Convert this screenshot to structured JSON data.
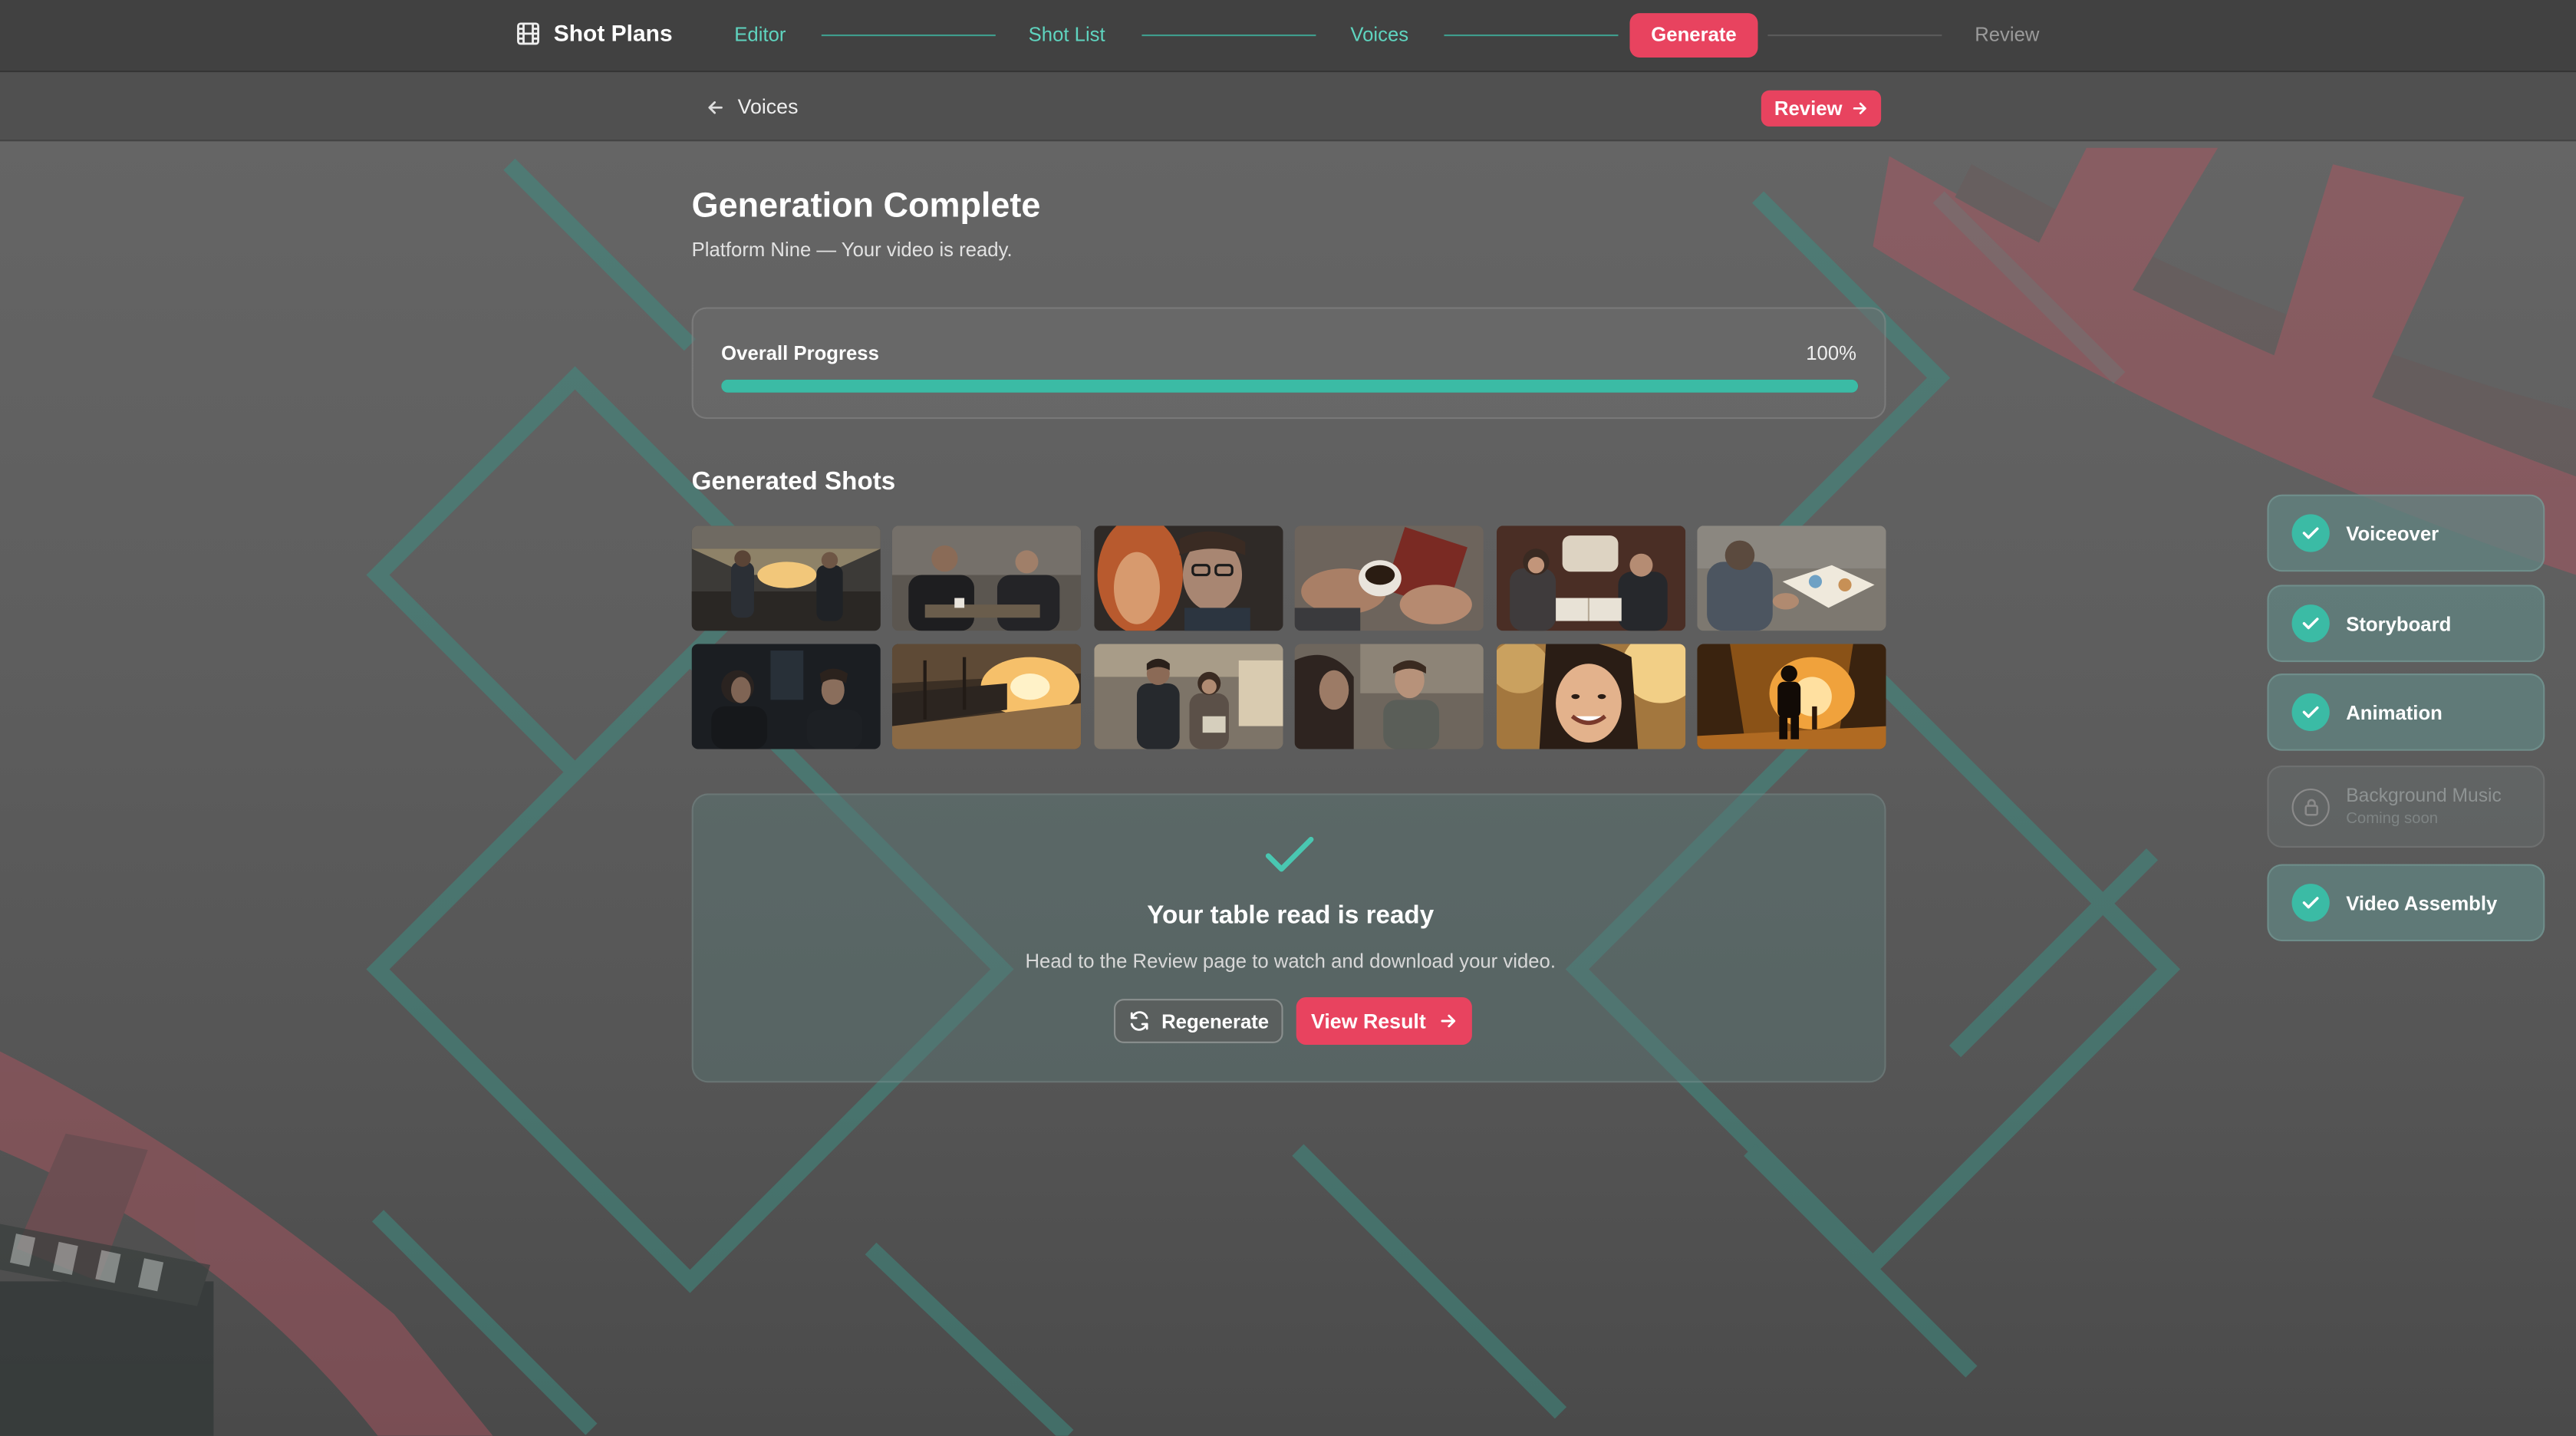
{
  "nav": {
    "brand": "Shot Plans",
    "steps": [
      {
        "label": "Editor",
        "state": "done"
      },
      {
        "label": "Shot List",
        "state": "done"
      },
      {
        "label": "Voices",
        "state": "done"
      },
      {
        "label": "Generate",
        "state": "active"
      },
      {
        "label": "Review",
        "state": "todo"
      }
    ]
  },
  "subbar": {
    "back_label": "Voices",
    "review_label": "Review"
  },
  "page": {
    "title": "Generation Complete",
    "subtitle": "Platform Nine — Your video is ready."
  },
  "progress": {
    "label": "Overall Progress",
    "value_text": "100%",
    "value": 100
  },
  "shots": {
    "title": "Generated Shots",
    "items": [
      "station-couple-talking",
      "two-people-at-table",
      "man-with-glasses-closeup",
      "hands-holding-cup",
      "couple-on-train",
      "man-reading-sketchbook",
      "dark-train-conversation",
      "sunlit-platform",
      "couple-on-platform",
      "woman-and-young-man",
      "smiling-woman",
      "silhouette-in-tunnel"
    ]
  },
  "ready": {
    "title": "Your table read is ready",
    "subtitle": "Head to the Review page to watch and download your video.",
    "regenerate_label": "Regenerate",
    "view_label": "View Result"
  },
  "status": {
    "items": [
      {
        "label": "Voiceover",
        "state": "complete"
      },
      {
        "label": "Storyboard",
        "state": "complete"
      },
      {
        "label": "Animation",
        "state": "complete"
      },
      {
        "label": "Background Music",
        "note": "Coming soon",
        "state": "locked"
      },
      {
        "label": "Video Assembly",
        "state": "complete"
      }
    ]
  },
  "colors": {
    "accent": "#e8435f",
    "teal": "#3bbba5",
    "teal_text": "#5fd4bf"
  }
}
